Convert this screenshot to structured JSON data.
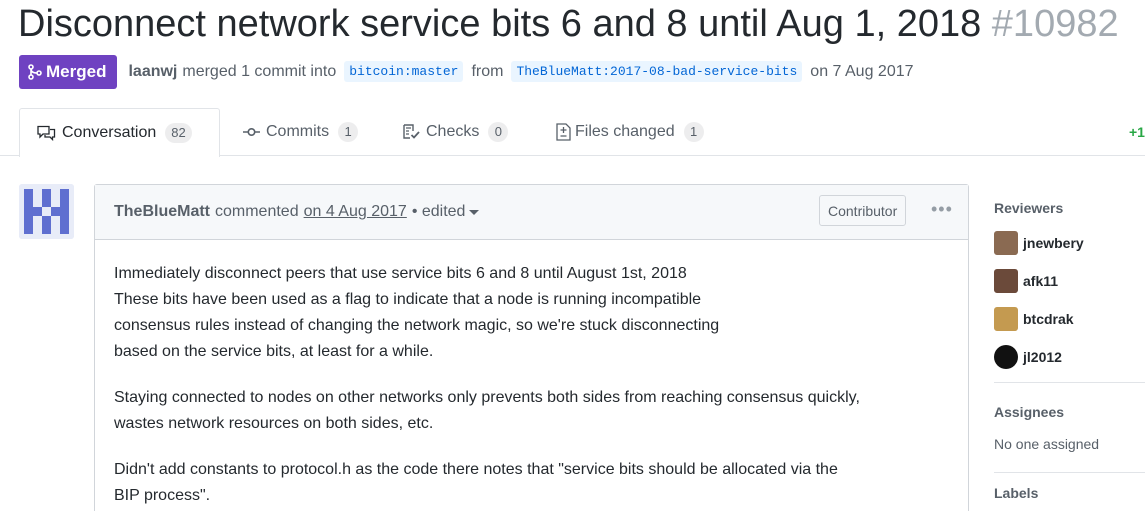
{
  "pr": {
    "title": "Disconnect network service bits 6 and 8 until Aug 1, 2018",
    "number": "#10982",
    "state": "Merged",
    "author": "laanwj",
    "merged_text": "merged 1 commit into",
    "base_branch": "bitcoin:master",
    "from_text": "from",
    "head_branch": "TheBlueMatt:2017-08-bad-service-bits",
    "date_text": "on 7 Aug 2017"
  },
  "tabs": [
    {
      "label": "Conversation",
      "count": "82",
      "icon": "comment-discussion-icon"
    },
    {
      "label": "Commits",
      "count": "1",
      "icon": "git-commit-icon"
    },
    {
      "label": "Checks",
      "count": "0",
      "icon": "checklist-icon"
    },
    {
      "label": "Files changed",
      "count": "1",
      "icon": "file-diff-icon"
    }
  ],
  "diffstat": "+1",
  "comment": {
    "author": "TheBlueMatt",
    "commented": "commented",
    "timestamp": "on 4 Aug 2017",
    "edited": "• edited",
    "role": "Contributor",
    "menu": "•••",
    "body": [
      [
        "Immediately disconnect peers that use service bits 6 and 8 until August 1st, 2018",
        "These bits have been used as a flag to indicate that a node is running incompatible",
        "consensus rules instead of changing the network magic, so we're stuck disconnecting",
        "based on the service bits, at least for a while."
      ],
      [
        "Staying connected to nodes on other networks only prevents both sides from reaching consensus quickly,",
        "wastes network resources on both sides, etc."
      ],
      [
        "Didn't add constants to protocol.h as the code there notes that \"service bits should be allocated via the",
        "BIP process\"."
      ]
    ]
  },
  "sidebar": {
    "reviewers_heading": "Reviewers",
    "reviewers": [
      {
        "name": "jnewbery",
        "color": "#8a6a52"
      },
      {
        "name": "afk11",
        "color": "#6b4a3a"
      },
      {
        "name": "btcdrak",
        "color": "#c49a50"
      },
      {
        "name": "jl2012",
        "color": "#111111"
      }
    ],
    "assignees_heading": "Assignees",
    "assignees_text": "No one assigned",
    "labels_heading": "Labels"
  },
  "colors": {
    "merged": "#6f42c1",
    "link": "#0366d6",
    "diffstat": "#28a745"
  }
}
